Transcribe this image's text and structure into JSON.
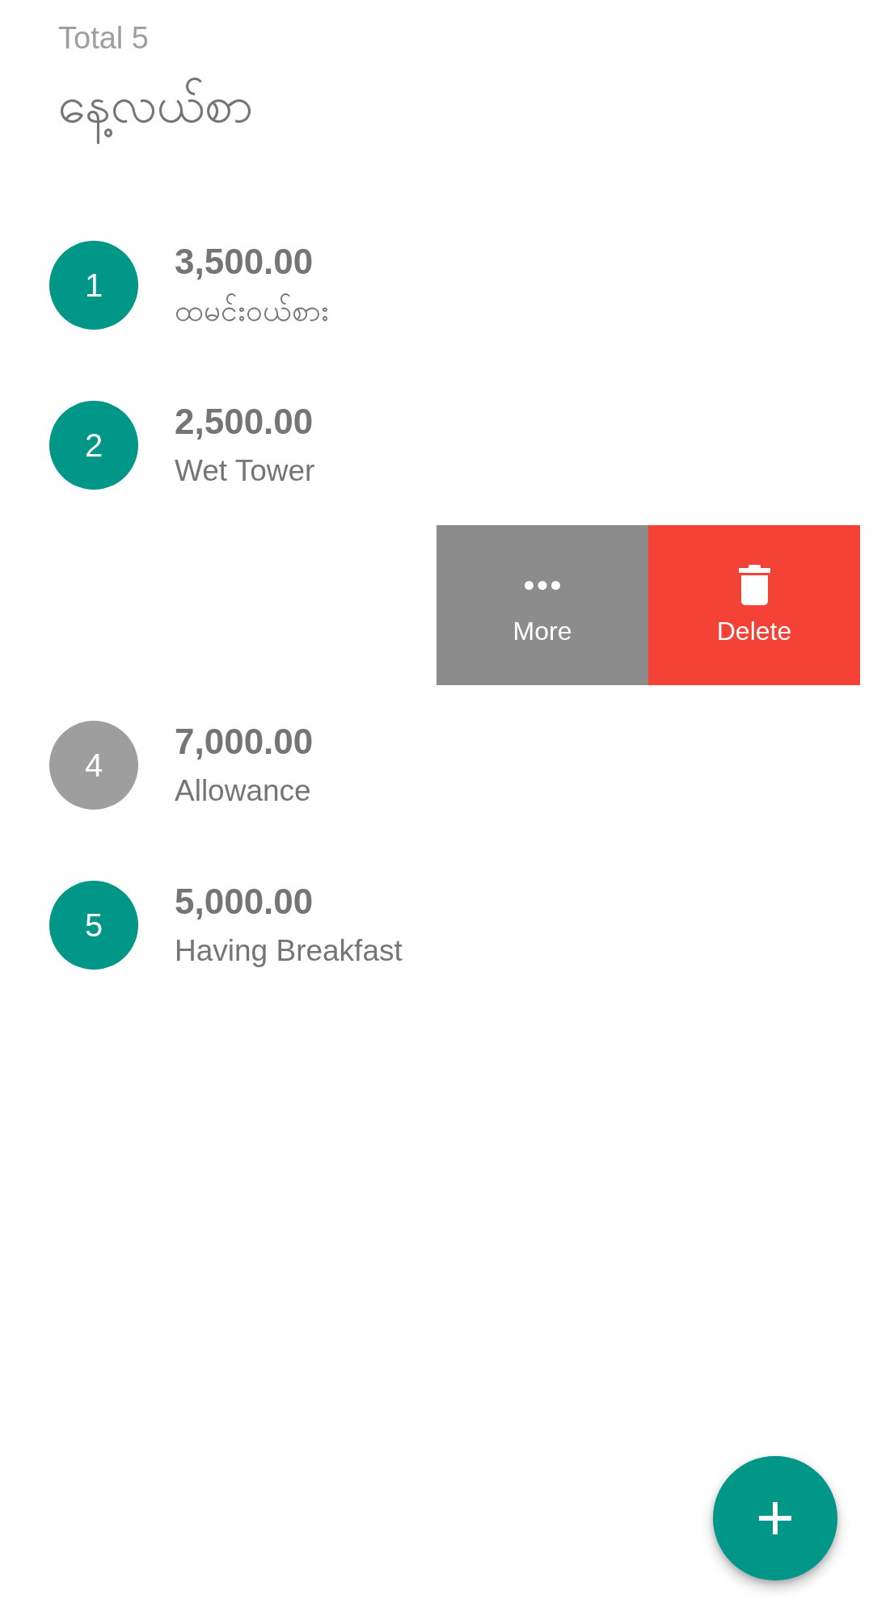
{
  "header": {
    "total": "Total 5",
    "title": "နေ့လယ်စာ"
  },
  "entries": [
    {
      "kind": "entry",
      "number": "1",
      "amount": "3,500.00",
      "note": "ထမင်းဝယ်စား",
      "color": "#009688"
    },
    {
      "kind": "entry",
      "number": "2",
      "amount": "2,500.00",
      "note": "Wet Tower",
      "color": "#009688"
    },
    {
      "kind": "swiped",
      "actions": [
        {
          "kind": "more",
          "label": "More"
        },
        {
          "kind": "delete",
          "label": "Delete"
        }
      ]
    },
    {
      "kind": "entry",
      "number": "4",
      "amount": "7,000.00",
      "note": "Allowance",
      "color": "#9e9e9e"
    },
    {
      "kind": "entry",
      "number": "5",
      "amount": "5,000.00",
      "note": "Having Breakfast",
      "color": "#009688"
    }
  ]
}
